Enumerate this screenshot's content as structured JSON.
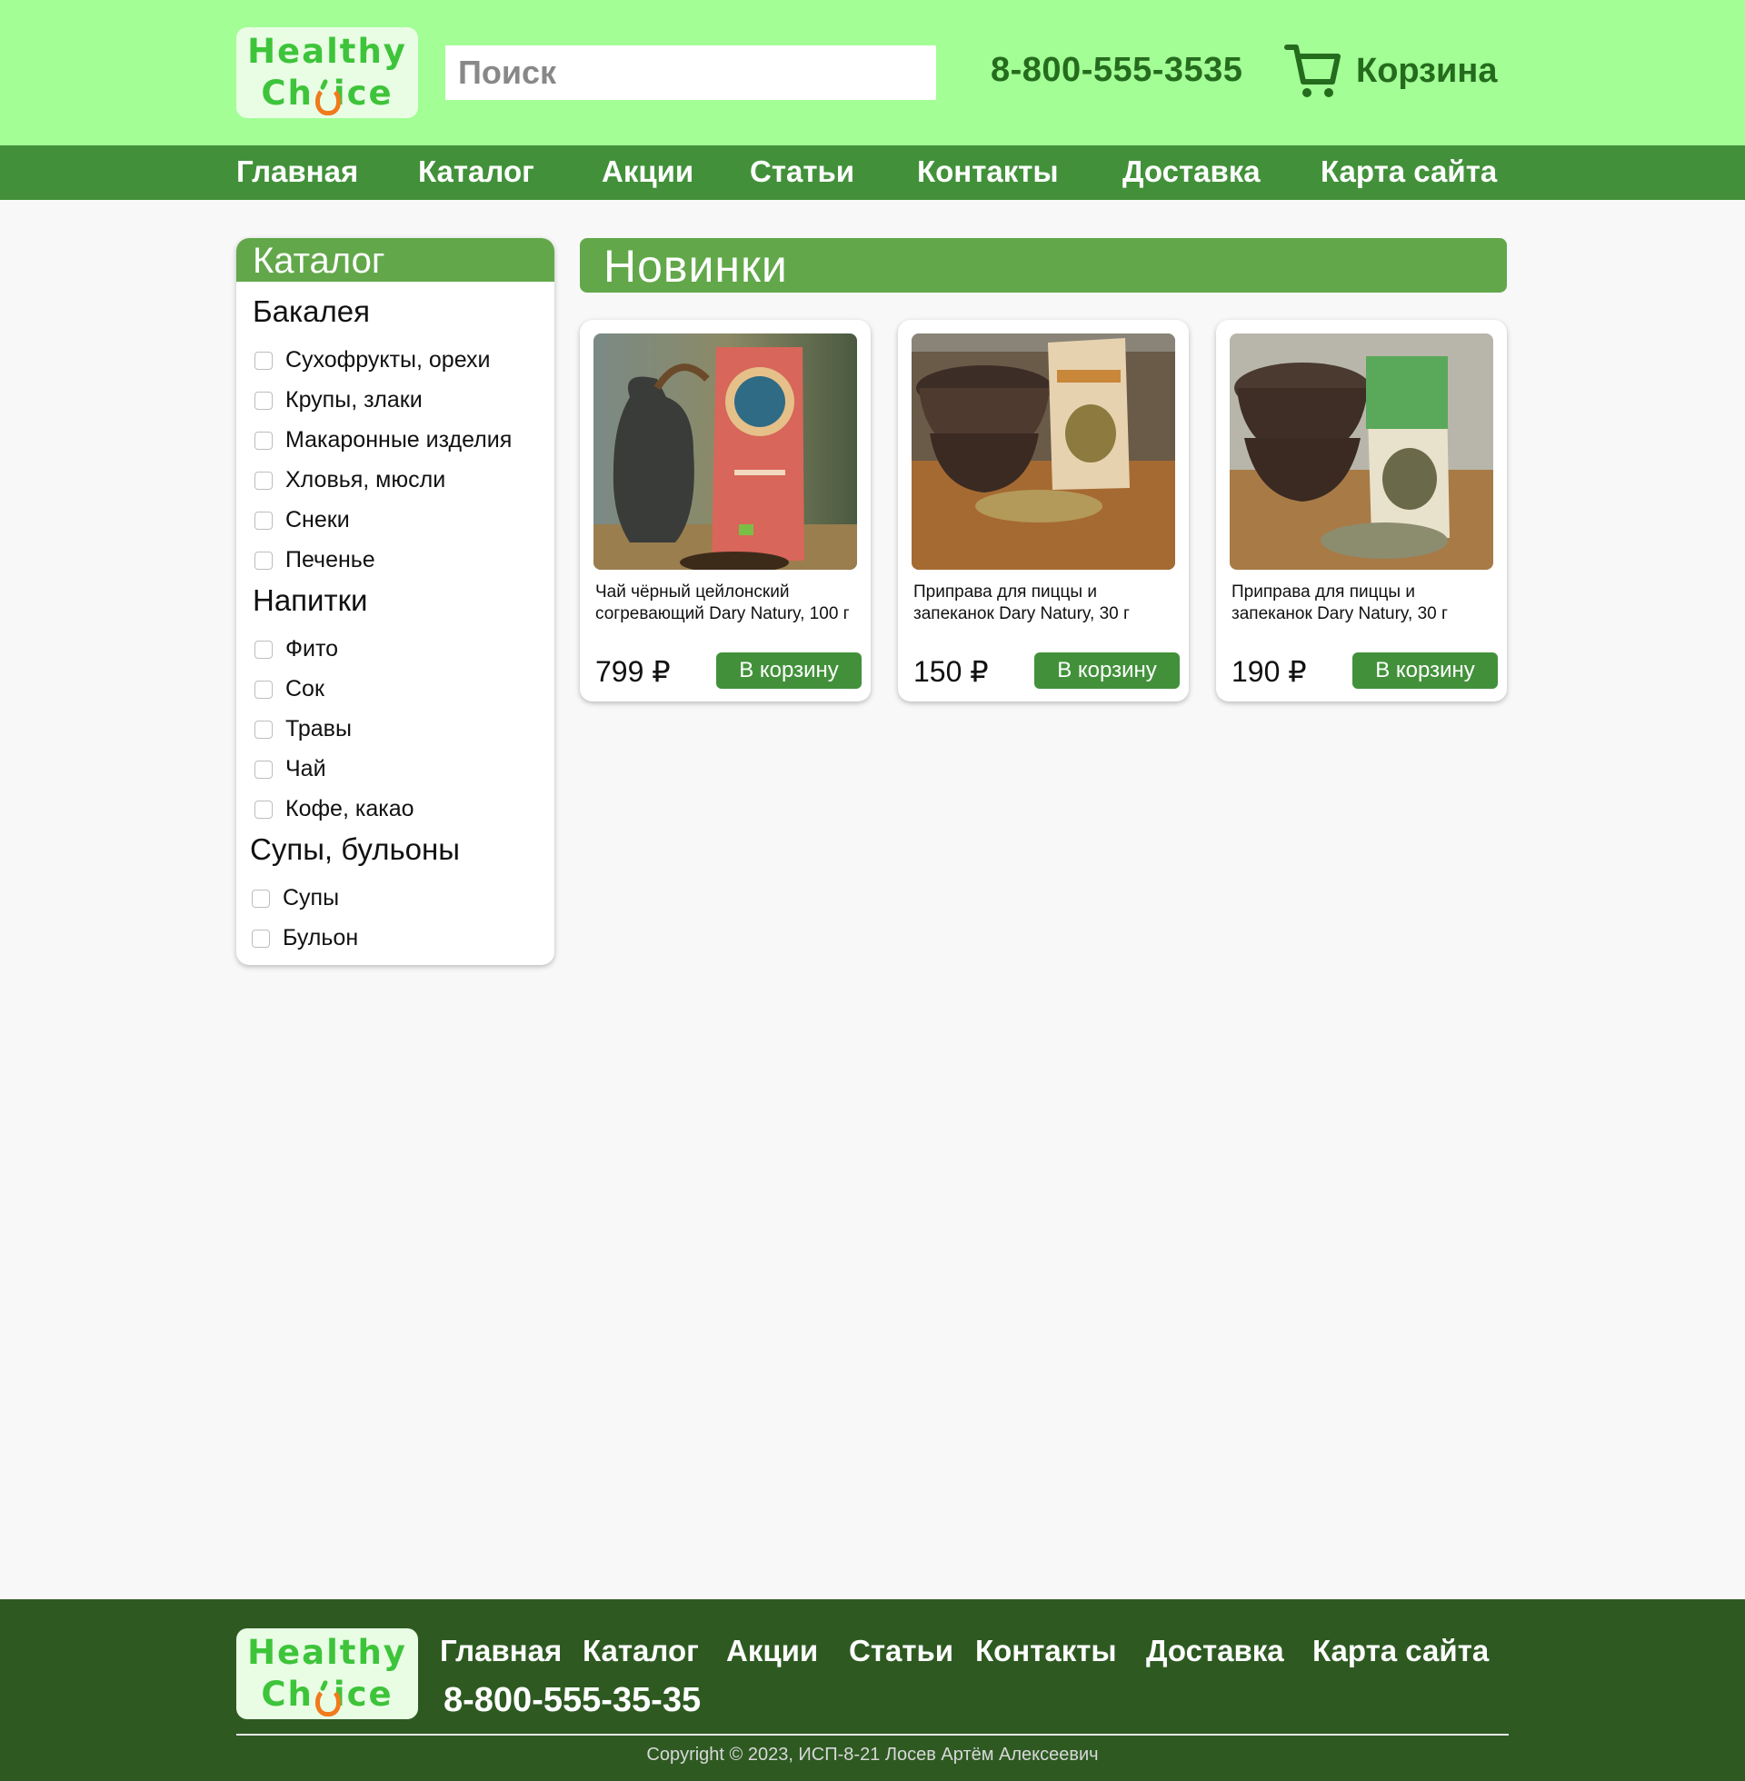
{
  "header": {
    "logo_line1": "Healthy",
    "logo_line2_a": "Ch",
    "logo_line2_b": "ice",
    "search_placeholder": "Поиск",
    "phone": "8-800-555-3535",
    "cart_label": "Корзина"
  },
  "nav": [
    "Главная",
    "Каталог",
    "Акции",
    "Статьи",
    "Контакты",
    "Доставка",
    "Карта сайта"
  ],
  "sidebar": {
    "title": "Каталог",
    "groups": [
      {
        "name": "Бакалея",
        "items": [
          "Сухофрукты, орехи",
          "Крупы, злаки",
          "Макаронные изделия",
          "Хловья, мюсли",
          "Снеки",
          "Печенье"
        ]
      },
      {
        "name": "Напитки",
        "items": [
          "Фито",
          "Сок",
          "Травы",
          "Чай",
          "Кофе, какао"
        ]
      },
      {
        "name": "Супы, бульоны",
        "items": [
          "Супы",
          "Бульон"
        ]
      }
    ]
  },
  "main": {
    "title": "Новинки",
    "products": [
      {
        "title": "Чай чёрный цейлонский согревающий Dary Natury, 100 г",
        "price": "799 ₽",
        "button": "В корзину"
      },
      {
        "title": "Приправа для пиццы и запеканок Dary Natury, 30 г",
        "price": "150 ₽",
        "button": "В корзину"
      },
      {
        "title": "Приправа для пиццы и запеканок Dary Natury, 30 г",
        "price": "190 ₽",
        "button": "В корзину"
      }
    ]
  },
  "footer": {
    "nav": [
      "Главная",
      "Каталог",
      "Акции",
      "Статьи",
      "Контакты",
      "Доставка",
      "Карта сайта"
    ],
    "phone": "8-800-555-35-35",
    "copyright": "Copyright © 2023, ИСП-8-21 Лосев Артём Алексеевич"
  },
  "colors": {
    "header_bg": "#a2fe95",
    "nav_bg": "#42913a",
    "section_head_bg": "#62a84a",
    "footer_bg": "#2e5a22",
    "accent_text": "#256b1d"
  }
}
